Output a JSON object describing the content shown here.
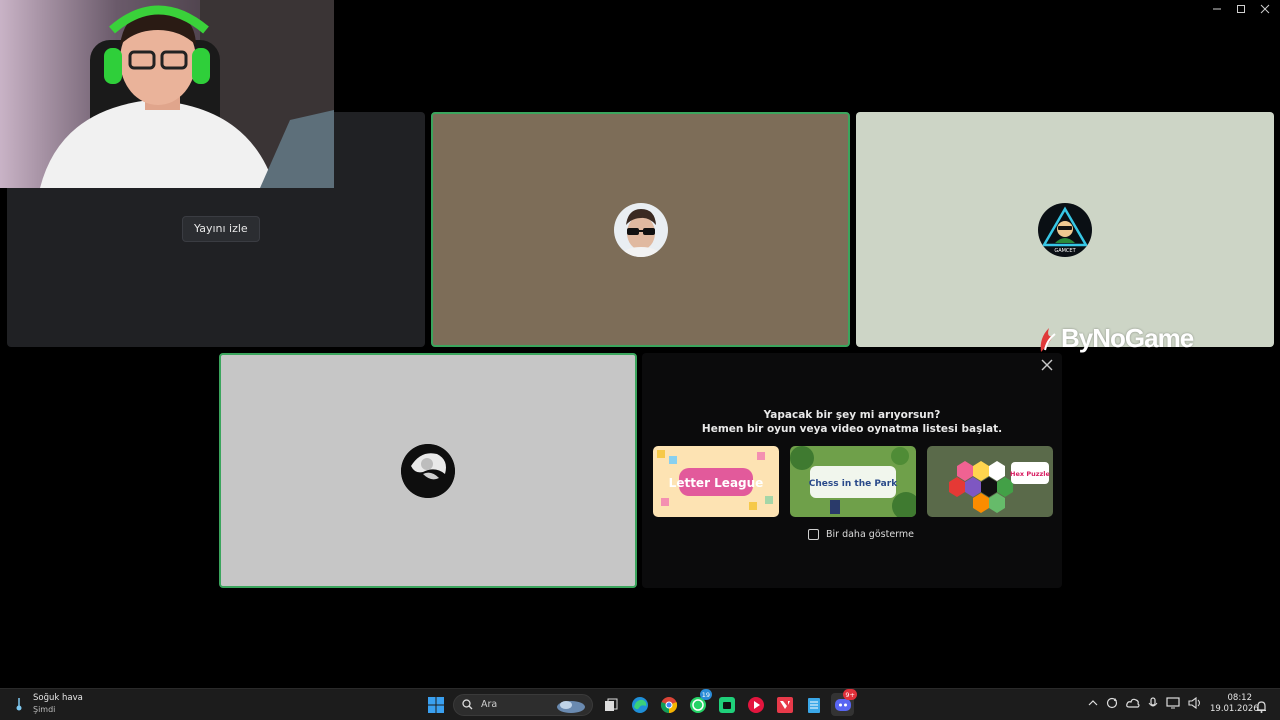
{
  "stream_tile": {
    "watch_label": "Yayını izle"
  },
  "watermark": {
    "brand": "ByNoGame"
  },
  "activity_panel": {
    "title_line1": "Yapacak bir şey mi arıyorsun?",
    "title_line2": "Hemen bir oyun veya video oynatma listesi başlat.",
    "games": [
      {
        "name": "Letter League"
      },
      {
        "name": "Chess in the Park"
      },
      {
        "name": "Hex Puzzle"
      }
    ],
    "dont_show_label": "Bir daha gösterme"
  },
  "avatar_labels": {
    "user3": "GAMCET"
  },
  "taskbar": {
    "weather_title": "Soğuk hava",
    "weather_sub": "Şimdi",
    "search_placeholder": "Ara",
    "whatsapp_badge": "19",
    "discord_badge": "9+",
    "time": "08:12",
    "date": "19.01.2026"
  },
  "colors": {
    "speaking_border": "#3ba55d",
    "user2_tile_bg": "#7d6d58",
    "user3_tile_bg": "#cdd5c6",
    "user4_tile_bg": "#c6c6c6",
    "stream_tile_bg": "#202124"
  }
}
